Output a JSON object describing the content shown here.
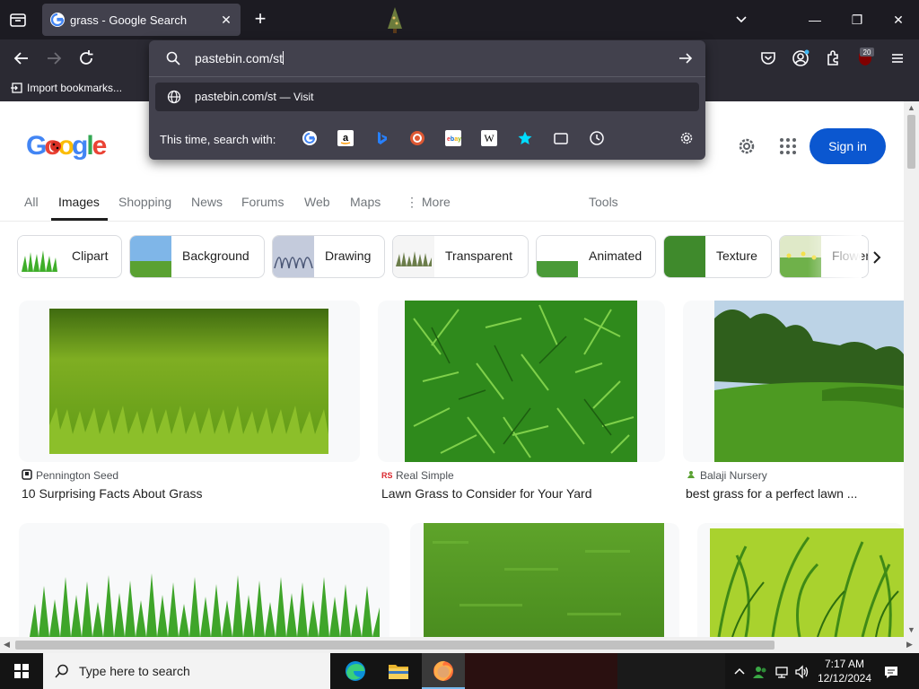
{
  "browser": {
    "tab": {
      "title": "grass - Google Search"
    },
    "url": {
      "value": "pastebin.com/st"
    },
    "suggestion": {
      "text": "pastebin.com/st",
      "action": "— Visit"
    },
    "engines_label": "This time, search with:",
    "bookmarks": [
      {
        "label": "Import bookmarks..."
      }
    ],
    "extension_badge": "20"
  },
  "google": {
    "signin_label": "Sign in",
    "tabs": [
      "All",
      "Images",
      "Shopping",
      "News",
      "Forums",
      "Web",
      "Maps",
      "More",
      "Tools"
    ],
    "active_tab": "Images",
    "chips": [
      "Clipart",
      "Background",
      "Drawing",
      "Transparent",
      "Animated",
      "Texture",
      "Flowers"
    ],
    "results": [
      {
        "source": "Pennington Seed",
        "caption": "10 Surprising Facts About Grass"
      },
      {
        "source": "Real Simple",
        "caption": "Lawn Grass to Consider for Your Yard"
      },
      {
        "source": "Balaji Nursery",
        "caption": "best grass for a perfect lawn ..."
      }
    ]
  },
  "taskbar": {
    "search_placeholder": "Type here to search",
    "time": "7:17 AM",
    "date": "12/12/2024"
  }
}
